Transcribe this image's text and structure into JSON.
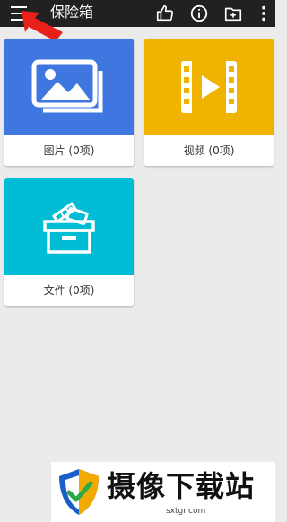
{
  "appbar": {
    "title": "保险箱",
    "icons": [
      "menu-icon",
      "thumbs-up-icon",
      "info-icon",
      "add-folder-icon",
      "more-vertical-icon"
    ]
  },
  "tiles": [
    {
      "label": "图片 (0项)",
      "icon": "image-icon",
      "color": "#3f76e0"
    },
    {
      "label": "视频 (0项)",
      "icon": "video-icon",
      "color": "#f0b400"
    },
    {
      "label": "文件 (0项)",
      "icon": "file-box-icon",
      "color": "#00bcd4"
    }
  ],
  "annotation": {
    "icon": "red-arrow-icon",
    "color": "#e8201a"
  },
  "watermark": {
    "brand": "摄像下载站",
    "url": "sxtgr.com"
  }
}
